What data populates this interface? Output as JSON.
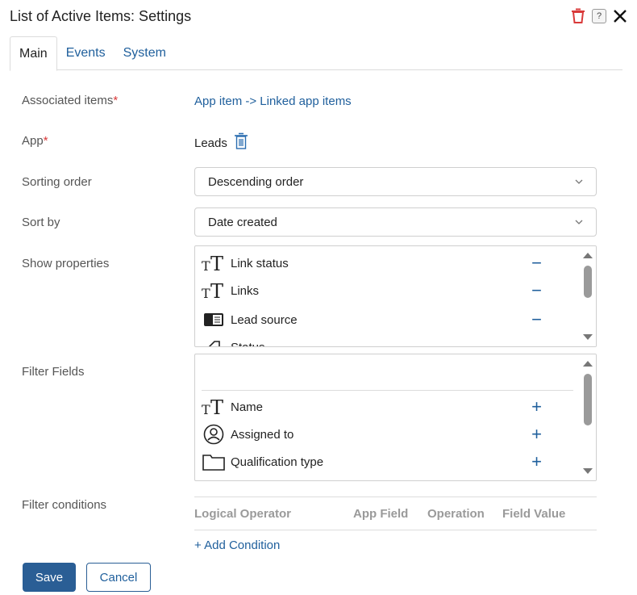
{
  "dialog": {
    "title": "List of Active Items: Settings"
  },
  "header_icons": {
    "delete": "trash-icon",
    "help": "?",
    "close": "close-icon"
  },
  "tabs": [
    {
      "label": "Main",
      "active": true
    },
    {
      "label": "Events",
      "active": false
    },
    {
      "label": "System",
      "active": false
    }
  ],
  "form": {
    "associated_items": {
      "label": "Associated items",
      "required": "*",
      "value": "App item -> Linked app items"
    },
    "app": {
      "label": "App",
      "required": "*",
      "value": "Leads"
    },
    "sorting_order": {
      "label": "Sorting order",
      "value": "Descending order"
    },
    "sort_by": {
      "label": "Sort by",
      "value": "Date created"
    },
    "show_properties": {
      "label": "Show properties",
      "items": [
        {
          "label": "Link status",
          "icon": "text-type-icon",
          "action": "−"
        },
        {
          "label": "Links",
          "icon": "text-type-icon",
          "action": "−"
        },
        {
          "label": "Lead source",
          "icon": "list-type-icon",
          "action": "−"
        },
        {
          "label": "Status",
          "icon": "status-icon",
          "action": ""
        }
      ]
    },
    "filter_fields": {
      "label": "Filter Fields",
      "items": [
        {
          "label": "Name",
          "icon": "text-type-icon",
          "action": "+"
        },
        {
          "label": "Assigned to",
          "icon": "user-icon",
          "action": "+"
        },
        {
          "label": "Qualification type",
          "icon": "folder-icon",
          "action": "+"
        }
      ]
    },
    "filter_conditions": {
      "label": "Filter conditions",
      "columns": [
        "Logical Operator",
        "App Field",
        "Operation",
        "Field Value"
      ],
      "add_label": "+ Add Condition"
    }
  },
  "footer": {
    "save": "Save",
    "cancel": "Cancel"
  },
  "colors": {
    "accent": "#2a5e95",
    "link": "#1f5f9c",
    "required": "#d93a3a",
    "delete_icon": "#d93a3a"
  }
}
